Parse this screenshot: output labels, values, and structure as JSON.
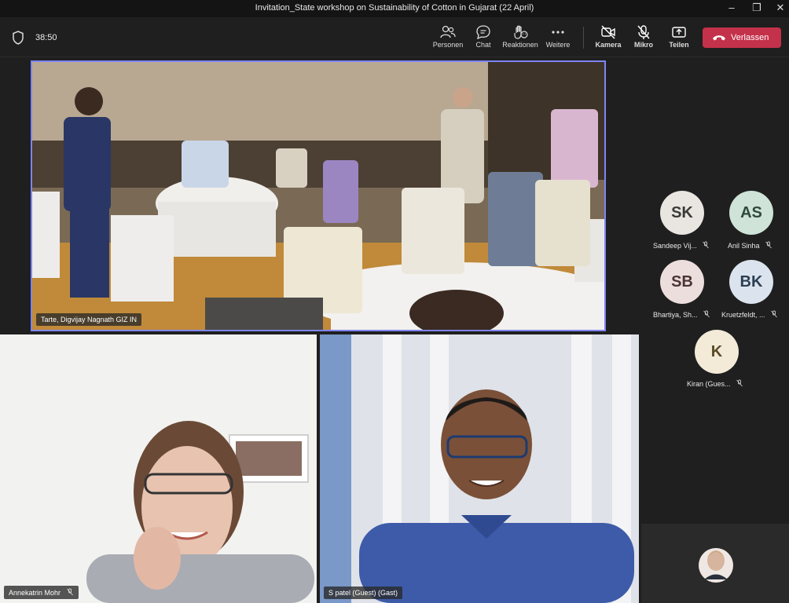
{
  "window": {
    "title": "Invitation_State workshop on Sustainability of Cotton in Gujarat (22 April)"
  },
  "meeting": {
    "timer": "38:50"
  },
  "toolbar": {
    "people": "Personen",
    "chat": "Chat",
    "reactions": "Reaktionen",
    "more": "Weitere",
    "camera": "Kamera",
    "mic": "Mikro",
    "share": "Teilen",
    "leave": "Verlassen"
  },
  "colors": {
    "leave": "#c4314b",
    "active_border": "#7f85f5",
    "background": "#1f1f1f"
  },
  "video_tiles": [
    {
      "name": "Tarte, Digvijay Nagnath GIZ IN"
    },
    {
      "name": "Annekatrin Mohr"
    },
    {
      "name": "S patel (Guest) (Gast)"
    }
  ],
  "participants": [
    {
      "initials": "SK",
      "name": "Sandeep Vij...",
      "color": "#e9e6e1",
      "text": "#3c3a36"
    },
    {
      "initials": "AS",
      "name": "Anil Sinha",
      "color": "#cfe3d8",
      "text": "#2e4a3d"
    },
    {
      "initials": "SB",
      "name": "Bhartiya, Sh...",
      "color": "#eddede",
      "text": "#4a3434"
    },
    {
      "initials": "BK",
      "name": "Kruetzfeldt, ...",
      "color": "#dbe4ee",
      "text": "#2e3f52"
    },
    {
      "initials": "K",
      "name": "Kiran (Gues...",
      "color": "#f3ead8",
      "text": "#5a4a28"
    }
  ],
  "icons": [
    "shield-icon",
    "people-icon",
    "chat-icon",
    "reactions-icon",
    "more-icon",
    "camera-off-icon",
    "mic-off-icon",
    "share-icon",
    "phone-icon",
    "minimize-icon",
    "restore-icon",
    "close-icon"
  ]
}
